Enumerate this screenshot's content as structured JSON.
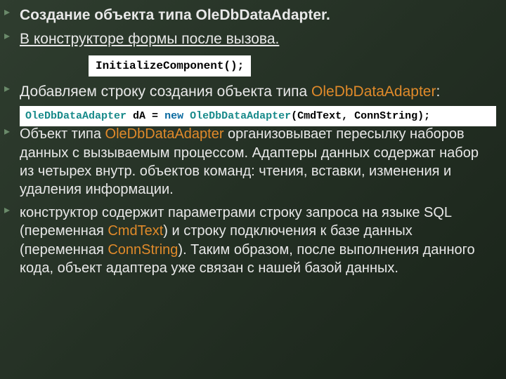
{
  "bullets": {
    "b1": "Создание объекта типа OleDbDataAdapter.",
    "b2": "В конструкторе формы после вызова.",
    "b3_a": "Добавляем строку создания объекта типа ",
    "b3_orange": "OleDbDataAdapter",
    "b3_b": ":",
    "b4_a": "Объект типа ",
    "b4_orange": "OleDbDataAdapter",
    "b4_b": " организовывает пересылку наборов данных с вызываемым процессом. Адаптеры данных содержат набор из четырех внутр. объектов команд: чтения, вставки, изменения и удаления информации.",
    "b5_a": "конструктор содержит параметрами строку запроса на языке SQL (переменная ",
    "b5_o1": "CmdText",
    "b5_b": ") и строку подключения к базе данных (переменная ",
    "b5_o2": "ConnString",
    "b5_c": "). Таким образом, после выполнения данного кода, объект адаптера уже связан с нашей базой данных."
  },
  "code1": "InitializeComponent();",
  "code2": {
    "cls1": "OleDbDataAdapter",
    "var": " dA ",
    "eq": "= ",
    "kw": "new",
    "sp": " ",
    "cls2": "OleDbDataAdapter",
    "args": "(CmdText, ConnString);"
  },
  "arrow": "▸"
}
